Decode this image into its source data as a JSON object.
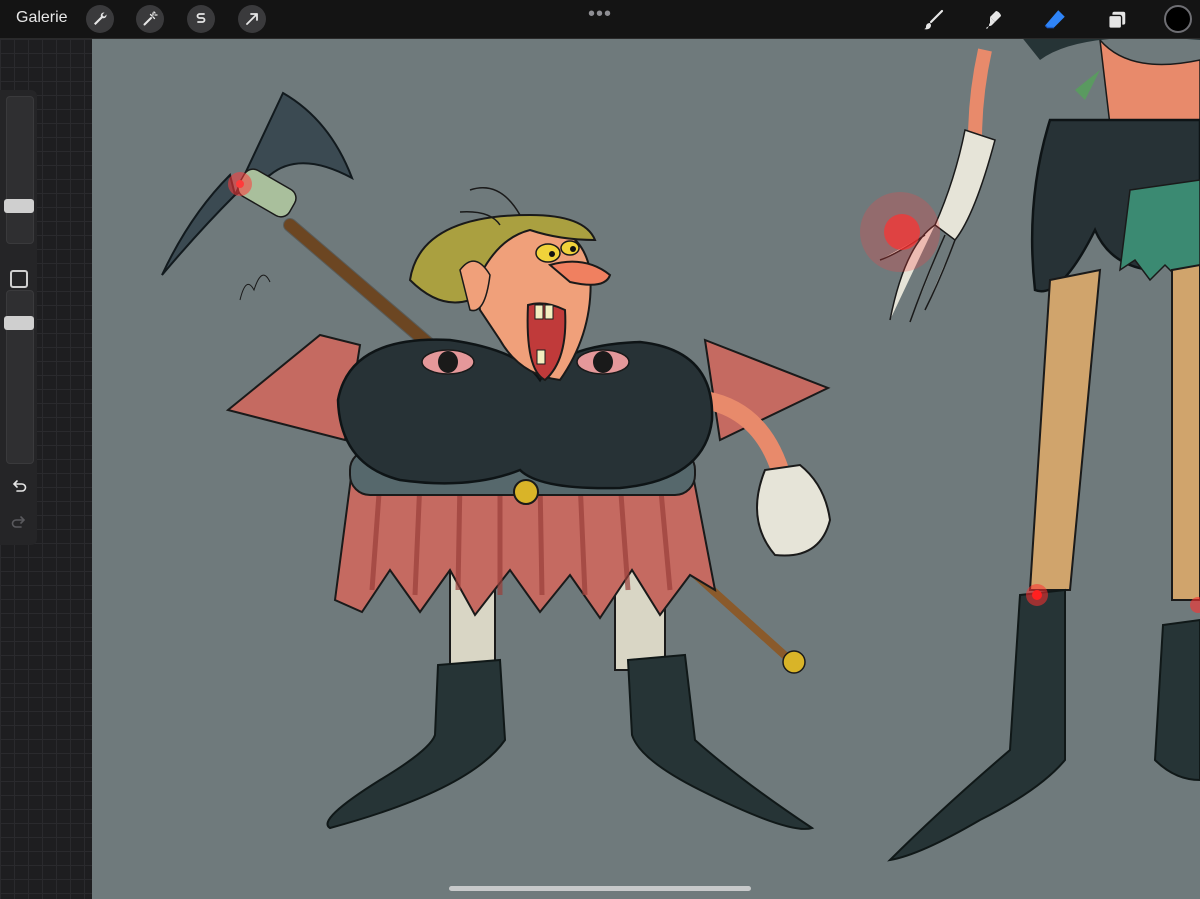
{
  "toolbar": {
    "gallery_label": "Galerie",
    "left_tools": [
      "wrench-icon",
      "magic-wand-icon",
      "selection-icon",
      "transform-arrow-icon"
    ],
    "more_indicator": "•••",
    "right_tools": [
      "brush-icon",
      "smudge-icon",
      "eraser-icon",
      "layers-icon"
    ],
    "active_tool": "eraser-icon",
    "active_color": "#000000",
    "accent_color": "#2f84f7"
  },
  "sidebar": {
    "brush_size_level": 0.18,
    "opacity_level": 0.95,
    "buttons": [
      "modify-square-icon",
      "undo-icon",
      "redo-icon"
    ]
  },
  "canvas": {
    "background_color": "#6f7a7c"
  }
}
